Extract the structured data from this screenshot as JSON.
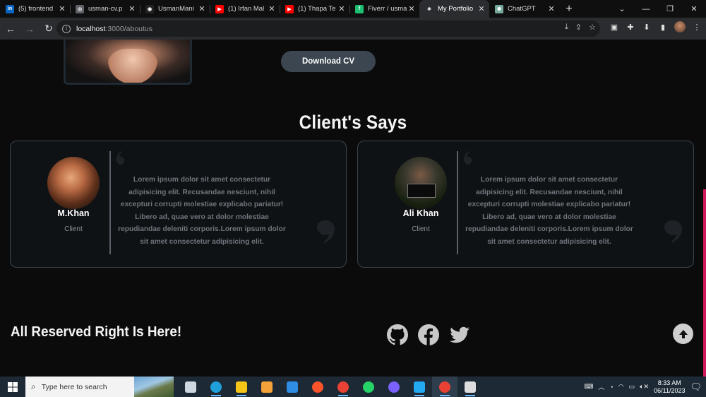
{
  "browser": {
    "tabs": [
      {
        "title": "(5) frontend",
        "icon": "linkedin-icon",
        "color": "#0a66c2",
        "glyph": "in",
        "active": false
      },
      {
        "title": "usman-cv.p",
        "icon": "globe-icon",
        "color": "#5f6368",
        "glyph": "◎",
        "active": false
      },
      {
        "title": "UsmanMani",
        "icon": "github-icon",
        "color": "#222222",
        "glyph": "◉",
        "active": false
      },
      {
        "title": "(1) Irfan Mal",
        "icon": "youtube-icon",
        "color": "#ff0000",
        "glyph": "▶",
        "active": false
      },
      {
        "title": "(1) Thapa Te",
        "icon": "youtube-icon",
        "color": "#ff0000",
        "glyph": "▶",
        "active": false
      },
      {
        "title": "Fiverr / usma",
        "icon": "fiverr-icon",
        "color": "#1dbf73",
        "glyph": "f",
        "active": false
      },
      {
        "title": "My Portfolio",
        "icon": "react-icon",
        "color": "#2b2c2f",
        "glyph": "⚛",
        "active": true
      },
      {
        "title": "ChatGPT",
        "icon": "chatgpt-icon",
        "color": "#74aa9c",
        "glyph": "✺",
        "active": false
      }
    ],
    "url_host": "localhost",
    "url_path": ":3000/aboutus"
  },
  "page": {
    "download_label": "Download CV",
    "section_title": "Client's Says",
    "testimonials": [
      {
        "name": "M.Khan",
        "role": "Client",
        "text": "Lorem ipsum dolor sit amet consectetur adipisicing elit. Recusandae nesciunt, nihil excepturi corrupti molestiae explicabo pariatur! Libero ad, quae vero at dolor molestiae repudiandae deleniti corporis.Lorem ipsum dolor sit amet consectetur adipisicing elit."
      },
      {
        "name": "Ali Khan",
        "role": "Client",
        "text": "Lorem ipsum dolor sit amet consectetur adipisicing elit. Recusandae nesciunt, nihil excepturi corrupti molestiae explicabo pariatur! Libero ad, quae vero at dolor molestiae repudiandae deleniti corporis.Lorem ipsum dolor sit amet consectetur adipisicing elit."
      }
    ],
    "footer_title": "All Reserved Right Is Here!",
    "accent_color": "#d2195e"
  },
  "taskbar": {
    "search_placeholder": "Type here to search",
    "time": "8:33 AM",
    "date": "06/11/2023",
    "apps": [
      {
        "name": "task-view-icon",
        "color": "#cfd8e0"
      },
      {
        "name": "edge-icon",
        "color": "#1fa0d8"
      },
      {
        "name": "file-explorer-icon",
        "color": "#f5c518"
      },
      {
        "name": "microsoft-store-icon",
        "color": "#f4a23a"
      },
      {
        "name": "mail-icon",
        "color": "#2f8de4"
      },
      {
        "name": "brave-icon",
        "color": "#fb542b"
      },
      {
        "name": "chrome-icon",
        "color": "#e94235"
      },
      {
        "name": "whatsapp-icon",
        "color": "#25d366"
      },
      {
        "name": "media-player-icon",
        "color": "#7b61ff"
      },
      {
        "name": "vscode-icon",
        "color": "#23a8f2"
      },
      {
        "name": "chrome-active-icon",
        "color": "#e94235"
      },
      {
        "name": "terminal-icon",
        "color": "#dddddd"
      }
    ]
  }
}
